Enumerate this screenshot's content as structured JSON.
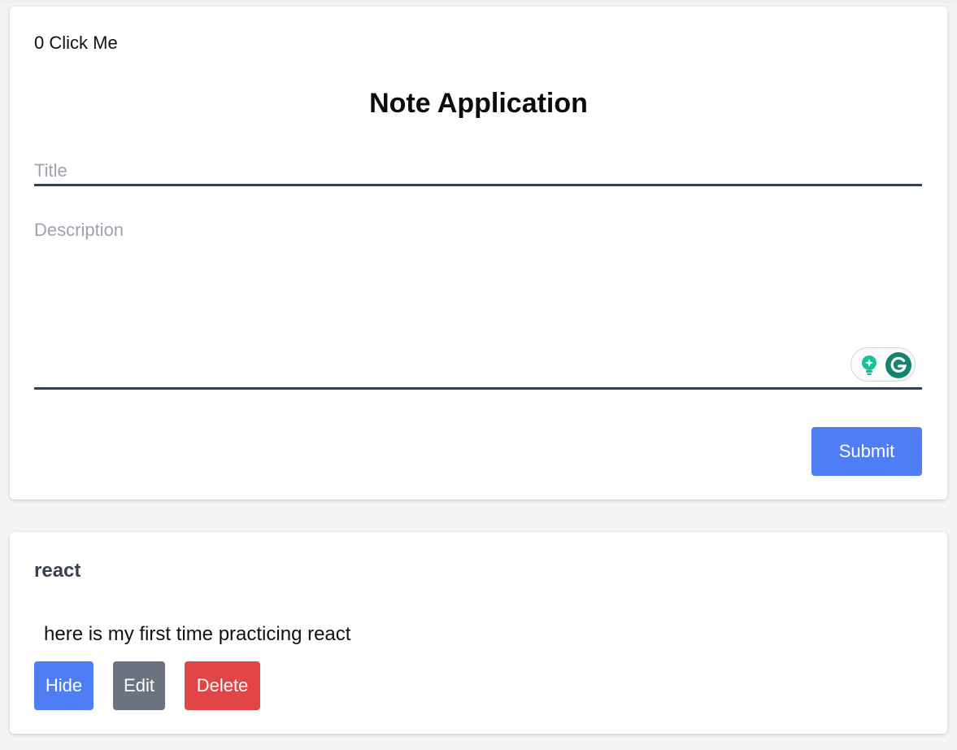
{
  "counter": {
    "count": "0",
    "label": "Click Me"
  },
  "form": {
    "heading": "Note Application",
    "title_placeholder": "Title",
    "description_placeholder": "Description",
    "submit_label": "Submit"
  },
  "notes": [
    {
      "title": "react",
      "description": "here is my first time practicing react",
      "hide_label": "Hide",
      "edit_label": "Edit",
      "delete_label": "Delete"
    }
  ],
  "colors": {
    "primary": "#4f7df6",
    "secondary": "#6b7280",
    "danger": "#e24545",
    "input_border": "#374151",
    "grammarly_green": "#15c39a"
  },
  "icons": {
    "grammarly_suggestion": "lightbulb-icon",
    "grammarly_logo": "grammarly-logo-icon"
  }
}
